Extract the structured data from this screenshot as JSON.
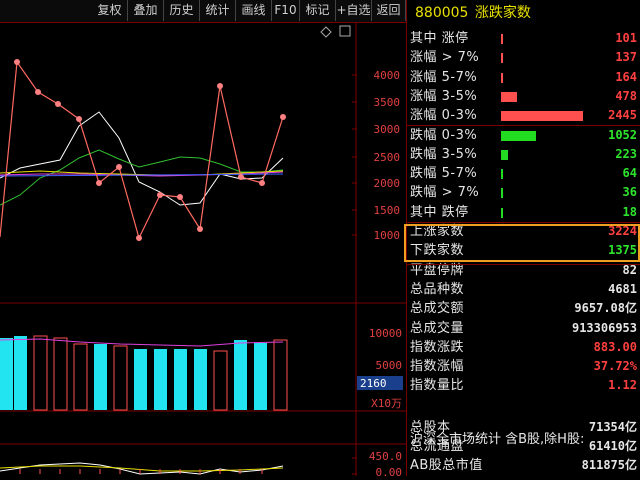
{
  "toolbar": {
    "buttons": [
      "复权",
      "叠加",
      "历史",
      "统计",
      "画线",
      "F10",
      "标记",
      "+自选",
      "返回"
    ]
  },
  "chart": {
    "price_ticks": [
      "4000",
      "3500",
      "3000",
      "2500",
      "2000",
      "1500",
      "1000"
    ],
    "volume_ticks": [
      "10000",
      "5000"
    ],
    "volume_unit": "X10万",
    "current_volume_label": "2160",
    "indicator_ticks": [
      "450.0",
      "0.00"
    ]
  },
  "panel": {
    "code": "880005",
    "name": "涨跌家数",
    "rows": [
      {
        "label": "其中 涨停",
        "value": "101",
        "color": "red",
        "bar_frac": 0.018
      },
      {
        "label": "涨幅 > 7%",
        "value": "137",
        "color": "red",
        "bar_frac": 0.025
      },
      {
        "label": "涨幅 5-7%",
        "value": "164",
        "color": "red",
        "bar_frac": 0.03
      },
      {
        "label": "涨幅 3-5%",
        "value": "478",
        "color": "red",
        "bar_frac": 0.2
      },
      {
        "label": "涨幅 0-3%",
        "value": "2445",
        "color": "red",
        "bar_frac": 1.0
      },
      {
        "label": "跌幅 0-3%",
        "value": "1052",
        "color": "green",
        "bar_frac": 0.43
      },
      {
        "label": "跌幅 3-5%",
        "value": "223",
        "color": "green",
        "bar_frac": 0.09
      },
      {
        "label": "跌幅 5-7%",
        "value": "64",
        "color": "green",
        "bar_frac": 0.03
      },
      {
        "label": "跌幅 > 7%",
        "value": "36",
        "color": "green",
        "bar_frac": 0.01
      },
      {
        "label": "其中 跌停",
        "value": "18",
        "color": "green",
        "bar_frac": 0.01
      },
      {
        "label": "上涨家数",
        "value": "3224",
        "color": "red",
        "bar_frac": 0
      },
      {
        "label": "下跌家数",
        "value": "1375",
        "color": "green",
        "bar_frac": 0
      },
      {
        "label": "平盘停牌",
        "value": "82",
        "color": "white",
        "bar_frac": 0
      },
      {
        "label": "总品种数",
        "value": "4681",
        "color": "white",
        "bar_frac": 0
      },
      {
        "label": "总成交额",
        "value": "9657.08亿",
        "color": "white",
        "bar_frac": 0
      },
      {
        "label": "总成交量",
        "value": "913306953",
        "color": "white",
        "bar_frac": 0
      },
      {
        "label": "指数涨跌",
        "value": "883.00",
        "color": "red",
        "bar_frac": 0
      },
      {
        "label": "指数涨幅",
        "value": "37.72%",
        "color": "red",
        "bar_frac": 0
      },
      {
        "label": "指数量比",
        "value": "1.12",
        "color": "red",
        "bar_frac": 0
      }
    ],
    "footer_title": "沪深全市场统计 含B股,除H股:",
    "footer_rows": [
      {
        "label": "总股本",
        "value": "71354亿",
        "color": "white"
      },
      {
        "label": "总流通盘",
        "value": "61410亿",
        "color": "white"
      },
      {
        "label": "AB股总市值",
        "value": "811875亿",
        "color": "white"
      }
    ],
    "bar_colors": {
      "red": "#ff5050",
      "green": "#22dd22"
    }
  }
}
